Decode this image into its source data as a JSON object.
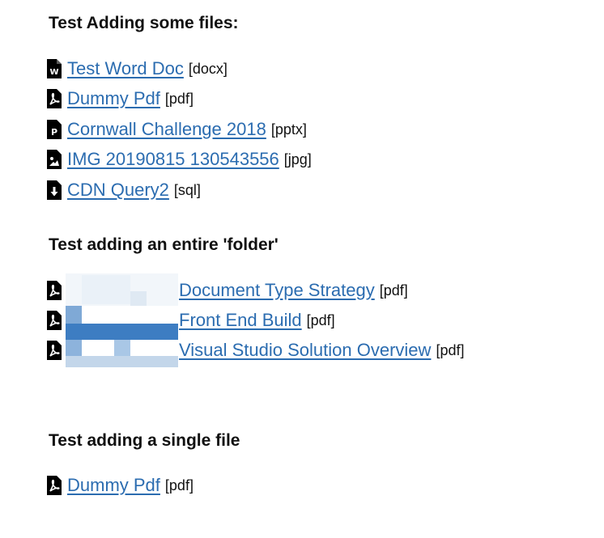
{
  "sections": [
    {
      "title": "Test Adding some files:",
      "files": [
        {
          "icon": "word-file-icon",
          "name": "Test Word Doc",
          "ext": "[docx]"
        },
        {
          "icon": "pdf-file-icon",
          "name": "Dummy Pdf",
          "ext": "[pdf]"
        },
        {
          "icon": "powerpoint-file-icon",
          "name": "Cornwall Challenge 2018",
          "ext": "[pptx]"
        },
        {
          "icon": "image-file-icon",
          "name": "IMG 20190815 130543556",
          "ext": "[jpg]"
        },
        {
          "icon": "download-file-icon",
          "name": "CDN Query2",
          "ext": "[sql]"
        }
      ]
    },
    {
      "title": "Test adding an entire 'folder'",
      "files": [
        {
          "icon": "pdf-file-icon",
          "name": "Document Type Strategy",
          "ext": "[pdf]"
        },
        {
          "icon": "pdf-file-icon",
          "name": "Front End Build",
          "ext": "[pdf]"
        },
        {
          "icon": "pdf-file-icon",
          "name": "Visual Studio Solution Overview",
          "ext": "[pdf]"
        }
      ]
    },
    {
      "title": "Test adding a single file",
      "files": [
        {
          "icon": "pdf-file-icon",
          "name": "Dummy Pdf",
          "ext": "[pdf]"
        }
      ]
    }
  ],
  "colors": {
    "link": "#2b6cb0",
    "text": "#111111",
    "icon": "#000000",
    "thumb_dark": "#3d7dc2",
    "thumb_mid": "#8db3dc",
    "thumb_light": "#c3d6ea"
  }
}
